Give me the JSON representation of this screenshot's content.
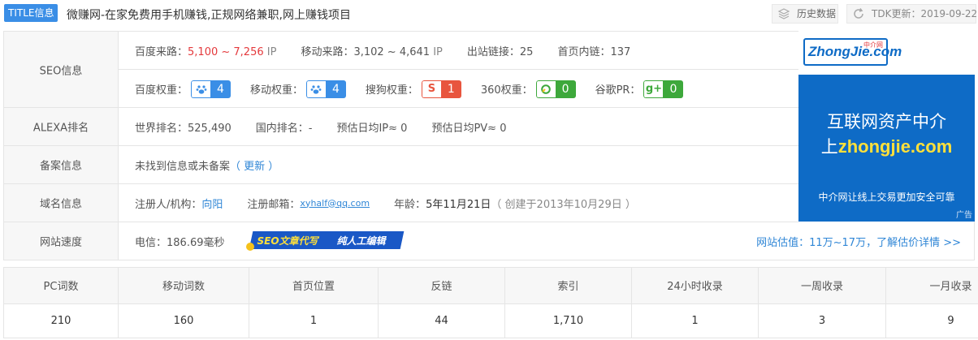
{
  "title_bar": {
    "badge": "TITLE信息",
    "title": "微赚网-在家免费用手机赚钱,正规网络兼职,网上赚钱项目",
    "history_button": "历史数据",
    "tdk_update": "TDK更新：2019-09-22"
  },
  "seo": {
    "label": "SEO信息",
    "baidu_source_label": "百度来路：",
    "baidu_source_value": "5,100 ~ 7,256",
    "baidu_source_unit": "IP",
    "mobile_source_label": "移动来路：",
    "mobile_source_value": "3,102 ~ 4,641",
    "mobile_source_unit": "IP",
    "outlinks_label": "出站链接：",
    "outlinks_value": "25",
    "homepage_links_label": "首页内链：",
    "homepage_links_value": "137",
    "weights": [
      {
        "label": "百度权重：",
        "icon": "baidu-paw-icon",
        "value": "4",
        "color": "#3a8ee6"
      },
      {
        "label": "移动权重：",
        "icon": "baidu-paw-icon",
        "value": "4",
        "color": "#3a8ee6"
      },
      {
        "label": "搜狗权重：",
        "icon": "sogou-icon",
        "value": "1",
        "color": "#e8553e"
      },
      {
        "label": "360权重：",
        "icon": "360-icon",
        "value": "0",
        "color": "#3da83b"
      },
      {
        "label": "谷歌PR：",
        "icon": "google-plus-icon",
        "value": "0",
        "color": "#3da83b"
      }
    ]
  },
  "alexa": {
    "label": "ALEXA排名",
    "world_rank": "世界排名：525,490",
    "domestic_rank": "国内排名：-",
    "daily_ip": "预估日均IP≈ 0",
    "daily_pv": "预估日均PV≈ 0"
  },
  "icp": {
    "label": "备案信息",
    "text": "未找到信息或未备案",
    "update_link": "（ 更新 ）"
  },
  "domain": {
    "label": "域名信息",
    "registrant_label": "注册人/机构：",
    "registrant_value": "向阳",
    "email_label": "注册邮箱：",
    "email_value": "xyhalf@qq.com",
    "age_label": "年龄：",
    "age_value": "5年11月21日",
    "created": "（ 创建于2013年10月29日 ）"
  },
  "speed": {
    "label": "网站速度",
    "telecom": "电信：186.69毫秒",
    "ad_text_1": "SEO文章代写",
    "ad_text_2": "纯人工编辑",
    "valuation_link": "网站估值：11万~17万，了解估价详情 >>"
  },
  "ad": {
    "logo_text": "ZhongJie.com",
    "logo_cn": "中介网",
    "line1": "互联网资产中介",
    "line2_prefix": "上",
    "line2_domain": "zhongjie.com",
    "slogan": "中介网让线上交易更加安全可靠",
    "tag": "广告"
  },
  "stats": {
    "headers": [
      "PC词数",
      "移动词数",
      "首页位置",
      "反链",
      "索引",
      "24小时收录",
      "一周收录",
      "一月收录"
    ],
    "values": [
      "210",
      "160",
      "1",
      "44",
      "1,710",
      "1",
      "3",
      "9"
    ]
  },
  "colors": {
    "accent": "#3a8ee6",
    "link": "#2f86d6",
    "highlight_red": "#e4393c",
    "ad_blue": "#0e6bc6"
  }
}
